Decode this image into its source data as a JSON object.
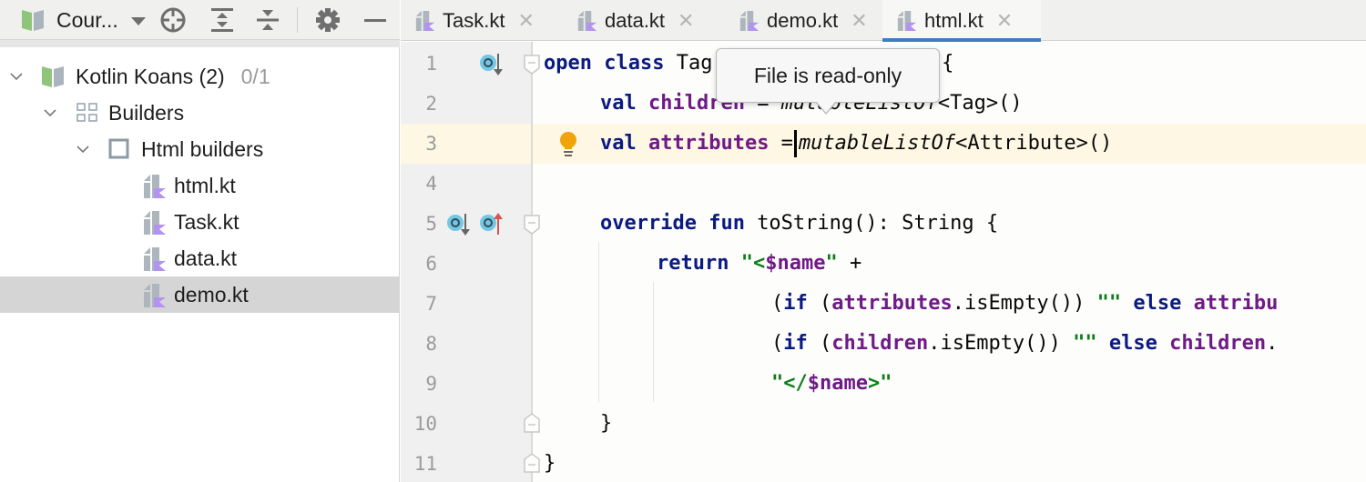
{
  "project_panel": {
    "course_selector": "Cour...",
    "toolbar_icons": [
      "locate-icon",
      "expand-all-icon",
      "collapse-all-icon",
      "gear-icon",
      "minimize-icon"
    ]
  },
  "tree": {
    "root": {
      "label": "Kotlin Koans (2)",
      "progress": "0/1",
      "expanded": true
    },
    "lesson": {
      "label": "Builders",
      "expanded": true
    },
    "task": {
      "label": "Html builders",
      "expanded": true
    },
    "files": [
      {
        "label": "html.kt",
        "selected": false
      },
      {
        "label": "Task.kt",
        "selected": false
      },
      {
        "label": "data.kt",
        "selected": false
      },
      {
        "label": "demo.kt",
        "selected": true
      }
    ]
  },
  "tabs": [
    {
      "label": "Task.kt",
      "active": false
    },
    {
      "label": "data.kt",
      "active": false
    },
    {
      "label": "demo.kt",
      "active": false
    },
    {
      "label": "html.kt",
      "active": true
    }
  ],
  "editor": {
    "current_line": 3,
    "line_numbers": [
      "1",
      "2",
      "3",
      "4",
      "5",
      "6",
      "7",
      "8",
      "9",
      "10",
      "11"
    ],
    "tooltip": "File is read-only",
    "lines": {
      "l1": {
        "kw": "open class ",
        "a": "T",
        "b": "ag(val name: Str",
        "c": "ing) {"
      },
      "l2": {
        "kw": "val ",
        "prop": "children",
        "eq": " = ",
        "fn": "mutableListOf",
        "rest": "<Tag>()"
      },
      "l3": {
        "kw": "val ",
        "prop": "attributes",
        "eq": " =",
        "fn": "mutableListOf",
        "rest": "<Attribute>()"
      },
      "l5": {
        "kw": "override fun ",
        "rest": "toString(): String {"
      },
      "l6": {
        "kw": "return ",
        "q1": "\"<",
        "tmpl": "$name",
        "q2": "\"",
        "rest": " +"
      },
      "l7": {
        "p1": "(",
        "kw1": "if",
        "p2": " (",
        "prop": "attributes",
        "call": ".isEmpty()) ",
        "str": "\"\"",
        "kw2": " else ",
        "prop2": "attribu"
      },
      "l8": {
        "p1": "(",
        "kw1": "if",
        "p2": " (",
        "prop": "children",
        "call": ".isEmpty()) ",
        "str": "\"\"",
        "kw2": " else ",
        "prop2": "children",
        "dot": "."
      },
      "l9": {
        "q1": "\"</",
        "tmpl": "$name",
        "q2": ">\""
      },
      "l10": {
        "rest": "}"
      },
      "l11": {
        "rest": "}"
      }
    }
  },
  "colors": {
    "keyword": "#0b1a80",
    "property": "#6f1a86",
    "string": "#107d1b",
    "active_tab_underline": "#3e7fc1",
    "current_line_bg": "#fdf7e4",
    "selection_bg": "#d5d5d5"
  }
}
